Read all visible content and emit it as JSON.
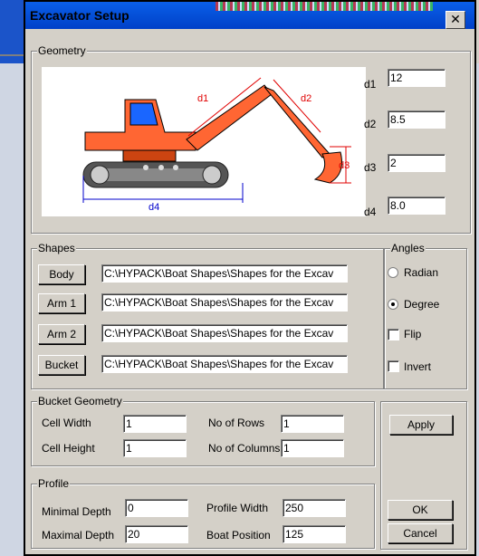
{
  "window": {
    "title": "Excavator Setup",
    "close_glyph": "✕"
  },
  "geometry": {
    "label": "Geometry",
    "diagram": {
      "d1": "d1",
      "d2": "d2",
      "d3": "d3",
      "d4": "d4"
    },
    "fields": [
      {
        "label": "d1",
        "value": "12"
      },
      {
        "label": "d2",
        "value": "8.5"
      },
      {
        "label": "d3",
        "value": "2"
      },
      {
        "label": "d4",
        "value": "8.0"
      }
    ]
  },
  "shapes": {
    "label": "Shapes",
    "rows": [
      {
        "button": "Body",
        "path": "C:\\HYPACK\\Boat Shapes\\Shapes for the Excav"
      },
      {
        "button": "Arm 1",
        "path": "C:\\HYPACK\\Boat Shapes\\Shapes for the Excav"
      },
      {
        "button": "Arm 2",
        "path": "C:\\HYPACK\\Boat Shapes\\Shapes for the Excav"
      },
      {
        "button": "Bucket",
        "path": "C:\\HYPACK\\Boat Shapes\\Shapes for the Excav"
      }
    ]
  },
  "angles": {
    "label": "Angles",
    "radian": "Radian",
    "degree": "Degree",
    "selected": "Degree",
    "flip": "Flip",
    "flip_checked": false,
    "invert": "Invert",
    "invert_checked": false
  },
  "bucket": {
    "label": "Bucket Geometry",
    "cell_width_label": "Cell Width",
    "cell_width": "1",
    "cell_height_label": "Cell Height",
    "cell_height": "1",
    "rows_label": "No of Rows",
    "rows": "1",
    "cols_label": "No of Columns",
    "cols": "1"
  },
  "profile": {
    "label": "Profile",
    "min_depth_label": "Minimal Depth",
    "min_depth": "0",
    "max_depth_label": "Maximal Depth",
    "max_depth": "20",
    "width_label": "Profile Width",
    "width": "250",
    "boat_pos_label": "Boat Position",
    "boat_pos": "125"
  },
  "buttons": {
    "apply": "Apply",
    "ok": "OK",
    "cancel": "Cancel"
  },
  "colors": {
    "body": "#ff6633",
    "cab_window": "#1a66ff",
    "track": "#555555",
    "dimension_red": "#e00000",
    "dimension_blue": "#0000cc",
    "titlebar": "#0a5fe8"
  }
}
